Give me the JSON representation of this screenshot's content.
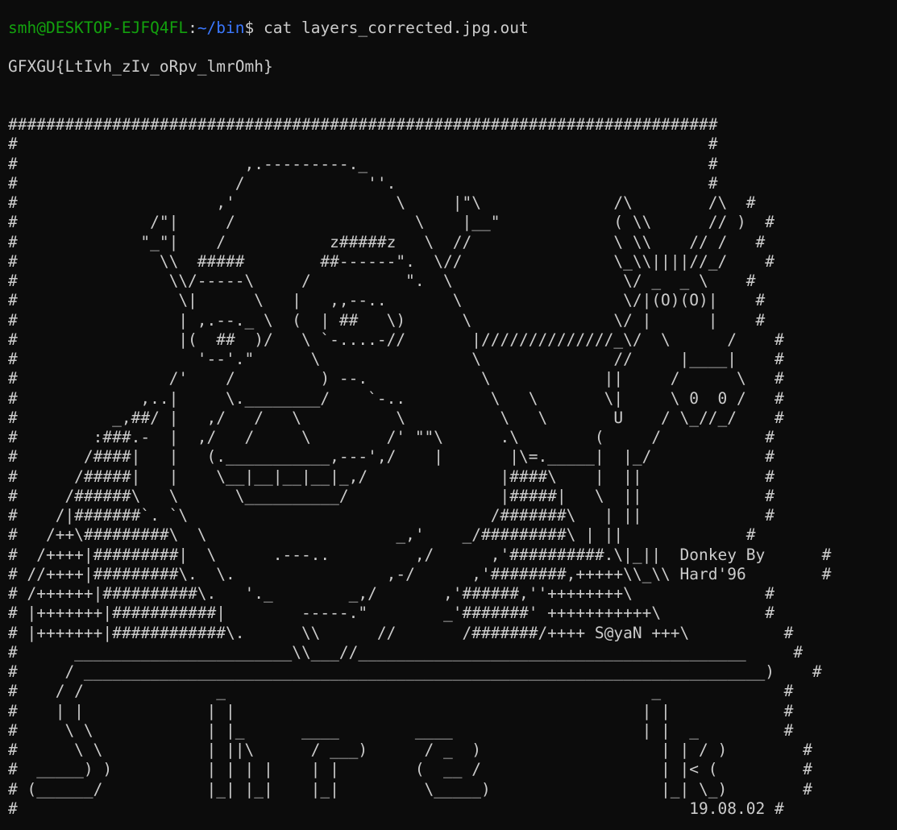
{
  "prompt": {
    "user_host": "smh@DESKTOP-EJFQ4FL",
    "separator": ":",
    "path": "~/bin",
    "symbol": "$ ",
    "command": "cat layers_corrected.jpg.out"
  },
  "output": {
    "flag": "GFXGU{LtIvh_zIv_oRpv_lmrOmh}",
    "art_lines": [
      "###########################################################################",
      "#                                                                         #",
      "#                        ,.---------._                                    #",
      "#                       /             ''.                                 #",
      "#                     ,'                 \\     |\"\\              /\\        /\\  #",
      "#              /\"|     /                   \\    |__\"            ( \\\\      // )  #",
      "#             \"_\"|    /           z#####z   \\  //               \\ \\\\    // /   #",
      "#               \\\\  #####        ##------\".  \\//                \\_\\\\||||//_/    #",
      "#                \\\\/-----\\     /          \".  \\                  \\/ _  _ \\    #",
      "#                 \\|      \\   |   ,,--..       \\                 \\/|(O)(O)|    #",
      "#                 | ,.--._ \\  (  | ##   \\)      \\               \\/ |      |    #",
      "#                 |(  ##  )/   \\ `-....-//       |//////////////_\\/  \\      /    #",
      "#                   '--'.\"      \\                \\              //     |____|    #",
      "#                /'    /         ) --.            \\            ||     /      \\   #",
      "#             ,..|     \\.________/    `-..         \\   \\       \\|     \\ 0  0 /   #",
      "#          _,##/ |   ,/   /   \\          \\          \\   \\       U    / \\_//_/    #",
      "#        :###.-  |  ,/   /     \\        /' \"\"\\      .\\        (     /           #",
      "#       /####|   |   (.___________,---',/    |       |\\=._____|  |_/            #",
      "#      /#####|   |    \\__|__|__|__|_,/              |####\\    |  ||             #",
      "#     /######\\   \\      \\__________/                |#####|   \\  ||             #",
      "#    /|#######`. `\\                                /#######\\   | ||             #",
      "#   /++\\#########\\  \\                    _,'    _/#########\\ | ||             #",
      "#  /++++|#########|  \\      .---..         ,/      ,'##########.\\|_||  Donkey By      #",
      "# //++++|#########\\.  \\.                ,-/      ,'########,+++++\\\\_\\\\ Hard'96        #",
      "# /++++++|##########\\.   '._        _,/       ,'######,''++++++++\\              #",
      "# |+++++++|###########|        -----.\"        _'#######' +++++++++++\\           #",
      "# |+++++++|############\\.      \\\\      //       /#######/++++ S@yaN +++\\          #",
      "#      _______________________\\\\___//_________________________________________     #",
      "#     / ________________________________________________________________________)    #",
      "#    / /              _                                             _             #",
      "#    | |             | |                                           | |            #",
      "#     \\ \\            | |_      ____        ____                    | |  _         #",
      "#      \\ \\           | ||\\      / ___)      / _  )                   | | / )        #",
      "#  _____) )          | | | |    | |        (  __ /                   | |< (         #",
      "# (______/           |_| |_|    |_|         \\_____)                  |_| \\_)        #",
      "#                                                                       19.08.02 #"
    ]
  },
  "colors": {
    "background": "#0c0c0c",
    "text": "#cccccc",
    "user_host": "#13a10e",
    "path": "#3b78ff"
  }
}
